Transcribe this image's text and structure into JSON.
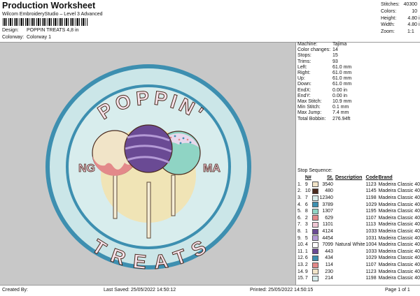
{
  "header": {
    "title": "Production Worksheet",
    "subtitle": "Wilcom EmbroideryStudio – Level 3 Advanced",
    "design_label": "Design:",
    "design_value": "POPPIN TREATS 4,8 in",
    "colorway_label": "Colorway:",
    "colorway_value": "Colorway 1"
  },
  "stats": [
    {
      "k": "Stitches:",
      "v": "40300",
      "u": ""
    },
    {
      "k": "Colors:",
      "v": "10",
      "u": ""
    },
    {
      "k": "Height:",
      "v": "4.80",
      "u": "in"
    },
    {
      "k": "Width:",
      "v": "4.80",
      "u": "in"
    },
    {
      "k": "Zoom:",
      "v": "1:1",
      "u": ""
    }
  ],
  "artwork": {
    "top_text": "POPPIN'",
    "bottom_text": "TREATS",
    "left_text": "NG",
    "right_text": "MA"
  },
  "info": [
    {
      "k": "Machine:",
      "v": "Tajima"
    },
    {
      "k": "Color changes:",
      "v": "14"
    },
    {
      "k": "Stops:",
      "v": "15"
    },
    {
      "k": "Trims:",
      "v": "93"
    },
    {
      "k": "Left:",
      "v": "61.0 mm"
    },
    {
      "k": "Right:",
      "v": "61.0 mm"
    },
    {
      "k": "Up:",
      "v": "61.0 mm"
    },
    {
      "k": "Down:",
      "v": "61.0 mm"
    },
    {
      "k": "EndX:",
      "v": "0.00 in"
    },
    {
      "k": "EndY:",
      "v": "0.00 in"
    },
    {
      "k": "Max Stitch:",
      "v": "10.9 mm"
    },
    {
      "k": "Min Stitch:",
      "v": "0.1 mm"
    },
    {
      "k": "Max Jump:",
      "v": "7.4 mm"
    },
    {
      "k": "Total Bobbin:",
      "v": "276.94ft"
    }
  ],
  "stop_sequence": {
    "title": "Stop Sequence:",
    "headers": [
      "",
      "N#",
      "",
      "St.",
      "Description",
      "Code",
      "Brand"
    ],
    "rows": [
      {
        "n": "1.",
        "num": "9",
        "color": "#f1e4c8",
        "st": "3540",
        "desc": "",
        "code": "1123",
        "brand": "Madeira Classic 40"
      },
      {
        "n": "2.",
        "num": "10",
        "color": "#4a2a1e",
        "st": "480",
        "desc": "",
        "code": "1145",
        "brand": "Madeira Classic 40"
      },
      {
        "n": "3.",
        "num": "7",
        "color": "#d6ecec",
        "st": "12340",
        "desc": "",
        "code": "1198",
        "brand": "Madeira Classic 40"
      },
      {
        "n": "4.",
        "num": "6",
        "color": "#3d8fb0",
        "st": "3789",
        "desc": "",
        "code": "1029",
        "brand": "Madeira Classic 40"
      },
      {
        "n": "5.",
        "num": "8",
        "color": "#8fd4c4",
        "st": "1307",
        "desc": "",
        "code": "1195",
        "brand": "Madeira Classic 40"
      },
      {
        "n": "6.",
        "num": "2",
        "color": "#e3898a",
        "st": "629",
        "desc": "",
        "code": "1107",
        "brand": "Madeira Classic 40"
      },
      {
        "n": "7.",
        "num": "3",
        "color": "#f0c7d4",
        "st": "1101",
        "desc": "",
        "code": "1113",
        "brand": "Madeira Classic 40"
      },
      {
        "n": "8.",
        "num": "1",
        "color": "#6a4a94",
        "st": "4124",
        "desc": "",
        "code": "1033",
        "brand": "Madeira Classic 40"
      },
      {
        "n": "9.",
        "num": "5",
        "color": "#b49ad6",
        "st": "4454",
        "desc": "",
        "code": "1031",
        "brand": "Madeira Classic 40"
      },
      {
        "n": "10.",
        "num": "4",
        "color": "#ffffff",
        "st": "7099",
        "desc": "Natural White",
        "code": "1004",
        "brand": "Madeira Classic 40"
      },
      {
        "n": "11.",
        "num": "1",
        "color": "#6a4a94",
        "st": "443",
        "desc": "",
        "code": "1033",
        "brand": "Madeira Classic 40"
      },
      {
        "n": "12.",
        "num": "6",
        "color": "#3d8fb0",
        "st": "434",
        "desc": "",
        "code": "1029",
        "brand": "Madeira Classic 40"
      },
      {
        "n": "13.",
        "num": "2",
        "color": "#e3898a",
        "st": "114",
        "desc": "",
        "code": "1107",
        "brand": "Madeira Classic 40"
      },
      {
        "n": "14.",
        "num": "9",
        "color": "#f1e4c8",
        "st": "230",
        "desc": "",
        "code": "1123",
        "brand": "Madeira Classic 40"
      },
      {
        "n": "15.",
        "num": "7",
        "color": "#d6ecec",
        "st": "214",
        "desc": "",
        "code": "1198",
        "brand": "Madeira Classic 40"
      }
    ]
  },
  "footer": {
    "created": "Created By:",
    "saved": "Last Saved: 25/05/2022 14:50:12",
    "printed": "Printed: 25/05/2022 14:50:15",
    "page": "Page 1 of 1"
  }
}
